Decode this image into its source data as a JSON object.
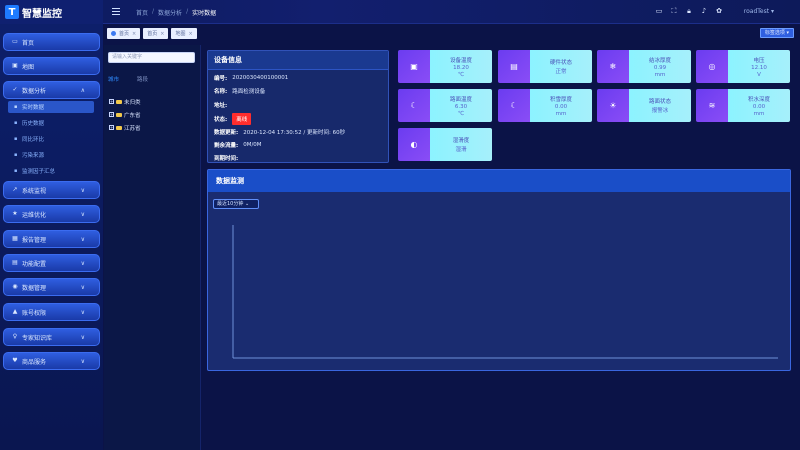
{
  "app": {
    "logo_mark": "T",
    "title": "智慧监控"
  },
  "breadcrumb": {
    "items": [
      "首页",
      "数据分析",
      "实时数据"
    ],
    "separator": "/"
  },
  "header": {
    "user": "roadTest"
  },
  "sidebar": {
    "items": [
      {
        "label": "首页",
        "icon": "monitor-icon"
      },
      {
        "label": "地图",
        "icon": "map-icon"
      },
      {
        "label": "数据分析",
        "icon": "chart-icon",
        "expanded": true
      },
      {
        "label": "系统监视",
        "icon": "trend-icon"
      },
      {
        "label": "运维优化",
        "icon": "star-icon"
      },
      {
        "label": "报告管理",
        "icon": "report-icon"
      },
      {
        "label": "功能配置",
        "icon": "config-icon"
      },
      {
        "label": "数据管理",
        "icon": "data-icon"
      },
      {
        "label": "账号权限",
        "icon": "user-icon"
      },
      {
        "label": "专家知识库",
        "icon": "bulb-icon"
      },
      {
        "label": "商品服务",
        "icon": "service-icon"
      }
    ],
    "sub_items": [
      "实时数据",
      "历史数据",
      "同比环比",
      "污染来源",
      "监测因子汇总"
    ]
  },
  "tabs": [
    {
      "label": "首页"
    },
    {
      "label": "首页"
    },
    {
      "label": "地图"
    }
  ],
  "tab_ops": "标签选项",
  "tree": {
    "search_placeholder": "请输入关键字",
    "tab_city": "城市",
    "tab_road": "路段",
    "nodes": [
      "未归类",
      "广东省",
      "江苏省"
    ]
  },
  "device": {
    "title": "设备信息",
    "rows": {
      "id": {
        "label": "编号:",
        "value": "2020030400100001"
      },
      "name": {
        "label": "名称:",
        "value": "路面检测设备"
      },
      "addr": {
        "label": "地址:",
        "value": ""
      },
      "status": {
        "label": "状态:",
        "value": "离线"
      },
      "update": {
        "label": "数据更新:",
        "value": "2020-12-04 17:30:52 / 更新时间: 60秒"
      },
      "storage": {
        "label": "剩余流量:",
        "value": "0M/0M"
      },
      "expire": {
        "label": "到期时间:",
        "value": ""
      }
    }
  },
  "cards": [
    {
      "label": "设备温度",
      "value": "18.20",
      "unit": "℃",
      "icon": "thermometer-icon"
    },
    {
      "label": "硬件状态",
      "value": "正常",
      "unit": "",
      "icon": "hardware-icon"
    },
    {
      "label": "结冰厚度",
      "value": "0.99",
      "unit": "mm",
      "icon": "snowflake-icon"
    },
    {
      "label": "电压",
      "value": "12.10",
      "unit": "V",
      "icon": "voltage-icon"
    },
    {
      "label": "路面温度",
      "value": "6.30",
      "unit": "℃",
      "icon": "road-temp-icon"
    },
    {
      "label": "积雪厚度",
      "value": "0.00",
      "unit": "mm",
      "icon": "snow-icon"
    },
    {
      "label": "路面状态",
      "value": "报警冰",
      "unit": "",
      "icon": "road-status-icon"
    },
    {
      "label": "积水深度",
      "value": "0.00",
      "unit": "mm",
      "icon": "water-icon"
    },
    {
      "label": "湿滑度",
      "value": "湿滑",
      "unit": "",
      "icon": "slippery-icon"
    }
  ],
  "monitor": {
    "title": "数据监测",
    "range_label": "最近10分钟"
  },
  "colors": {
    "accent": "#1e7bff",
    "offline": "#ff2d2d",
    "card_bg": "#8cf3ff",
    "card_icon": "#7a44f2"
  }
}
